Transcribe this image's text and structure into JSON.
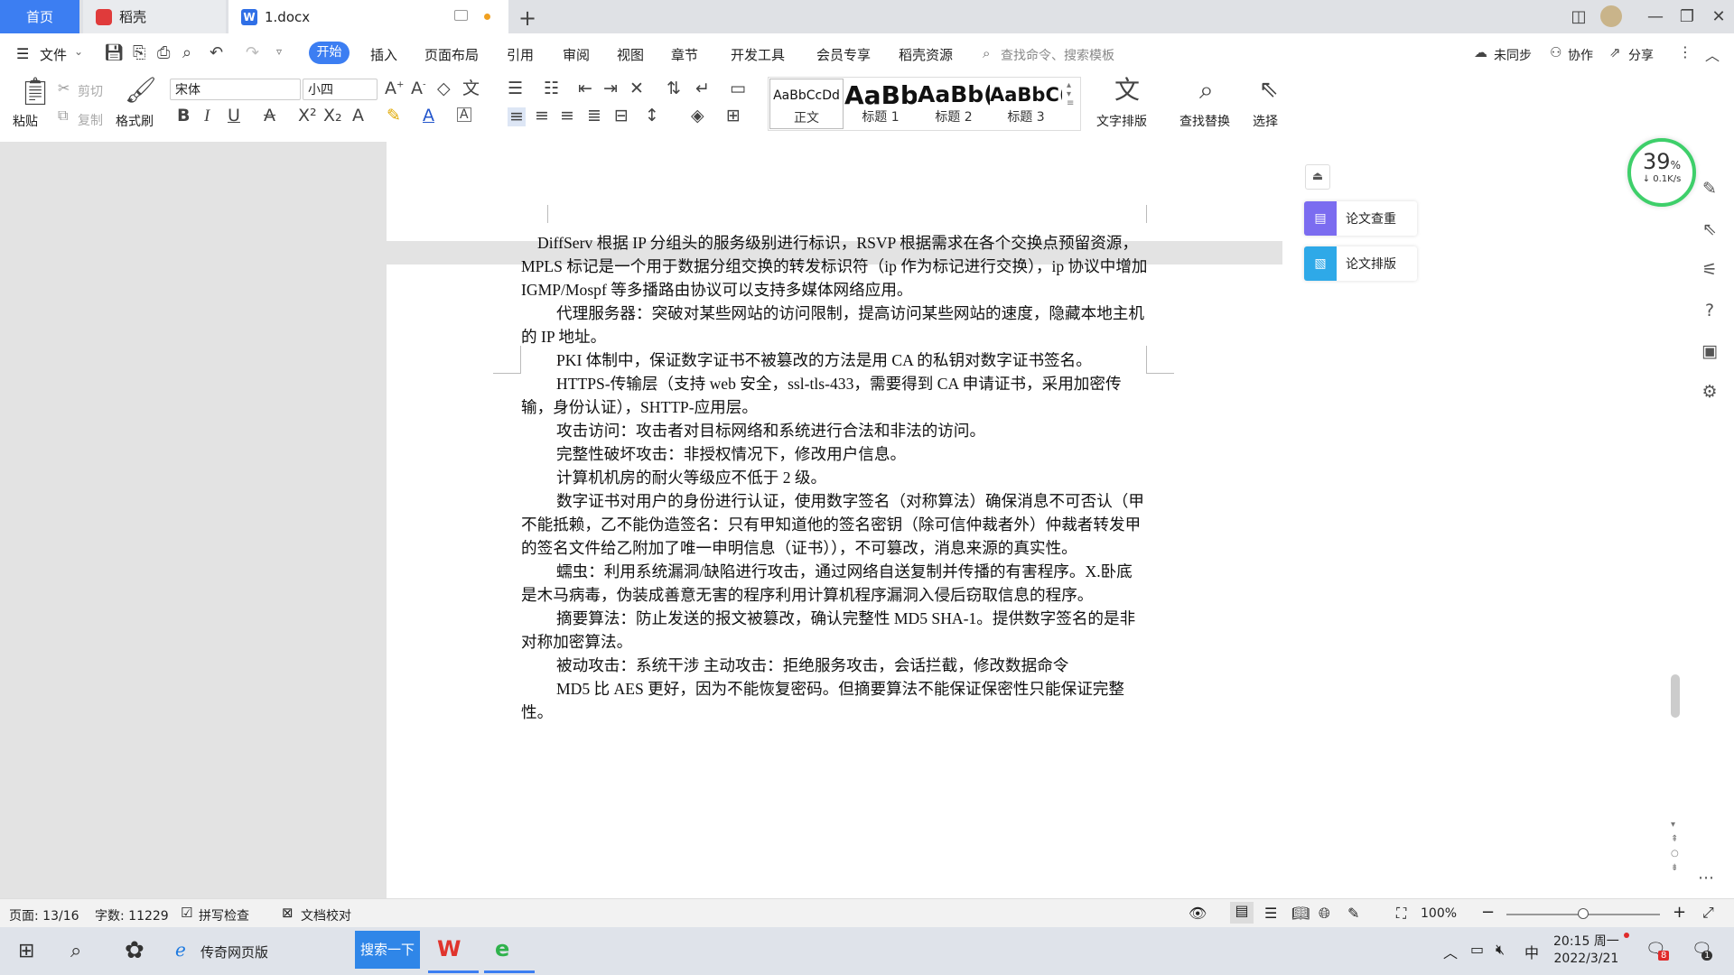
{
  "tabs": {
    "home": "首页",
    "daoke": "稻壳",
    "doc": "1.docx"
  },
  "menu": {
    "file": "文件",
    "items": [
      "开始",
      "插入",
      "页面布局",
      "引用",
      "审阅",
      "视图",
      "章节",
      "开发工具",
      "会员专享",
      "稻壳资源"
    ],
    "search_placeholder": "查找命令、搜索模板",
    "sync": "未同步",
    "collab": "协作",
    "share": "分享"
  },
  "ribbon": {
    "paste": "粘贴",
    "cut": "剪切",
    "copy": "复制",
    "format_painter": "格式刷",
    "font_name": "宋体",
    "font_size": "小四",
    "styles": [
      {
        "preview": "AaBbCcDd",
        "name": "正文"
      },
      {
        "preview": "AaBb",
        "name": "标题 1"
      },
      {
        "preview": "AaBb(",
        "name": "标题 2"
      },
      {
        "preview": "AaBbC(",
        "name": "标题 3"
      }
    ],
    "text_layout": "文字排版",
    "find_replace": "查找替换",
    "select": "选择"
  },
  "document": {
    "paragraphs": [
      "DiffServ 根据 IP 分组头的服务级别进行标识，RSVP 根据需求在各个交换点预留资源，MPLS 标记是一个用于数据分组交换的转发标识符（ip 作为标记进行交换），ip 协议中增加 IGMP/Mospf 等多播路由协议可以支持多媒体网络应用。",
      "代理服务器：突破对某些网站的访问限制，提高访问某些网站的速度，隐藏本地主机的 IP 地址。",
      "PKI 体制中，保证数字证书不被篡改的方法是用 CA 的私钥对数字证书签名。",
      "HTTPS-传输层（支持 web 安全，ssl-tls-433，需要得到 CA 申请证书，采用加密传输，身份认证），SHTTP-应用层。",
      "攻击访问：攻击者对目标网络和系统进行合法和非法的访问。",
      "完整性破坏攻击：非授权情况下，修改用户信息。",
      "计算机机房的耐火等级应不低于 2 级。",
      "数字证书对用户的身份进行认证，使用数字签名（对称算法）确保消息不可否认（甲不能抵赖，乙不能伪造签名：只有甲知道他的签名密钥（除可信仲裁者外）仲裁者转发甲的签名文件给乙附加了唯一申明信息（证书）），不可篡改，消息来源的真实性。",
      "蠕虫：利用系统漏洞/缺陷进行攻击，通过网络自送复制并传播的有害程序。X.卧底是木马病毒，伪装成善意无害的程序利用计算机程序漏洞入侵后窃取信息的程序。",
      "摘要算法：防止发送的报文被篡改，确认完整性 MD5 SHA-1。提供数字签名的是非对称加密算法。",
      "被动攻击：系统干涉 主动攻击：拒绝服务攻击，会话拦截，修改数据命令",
      "MD5 比 AES 更好，因为不能恢复密码。但摘要算法不能保证保密性只能保证完整性。"
    ]
  },
  "panel": {
    "check": "论文查重",
    "layout": "论文排版"
  },
  "speed_widget": {
    "percent": "39",
    "unit": "%",
    "rate": "↓ 0.1K/s"
  },
  "status": {
    "page": "页面: 13/16",
    "words": "字数: 11229",
    "spell": "拼写检查",
    "proof": "文档校对",
    "zoom": "100%",
    "zoom_level": 0.5
  },
  "taskbar": {
    "browser": "传奇网页版",
    "search_btn": "搜索一下",
    "time": "20:15 周一",
    "date": "2022/3/21",
    "ime": "中",
    "notif": "8",
    "chat": "1"
  }
}
